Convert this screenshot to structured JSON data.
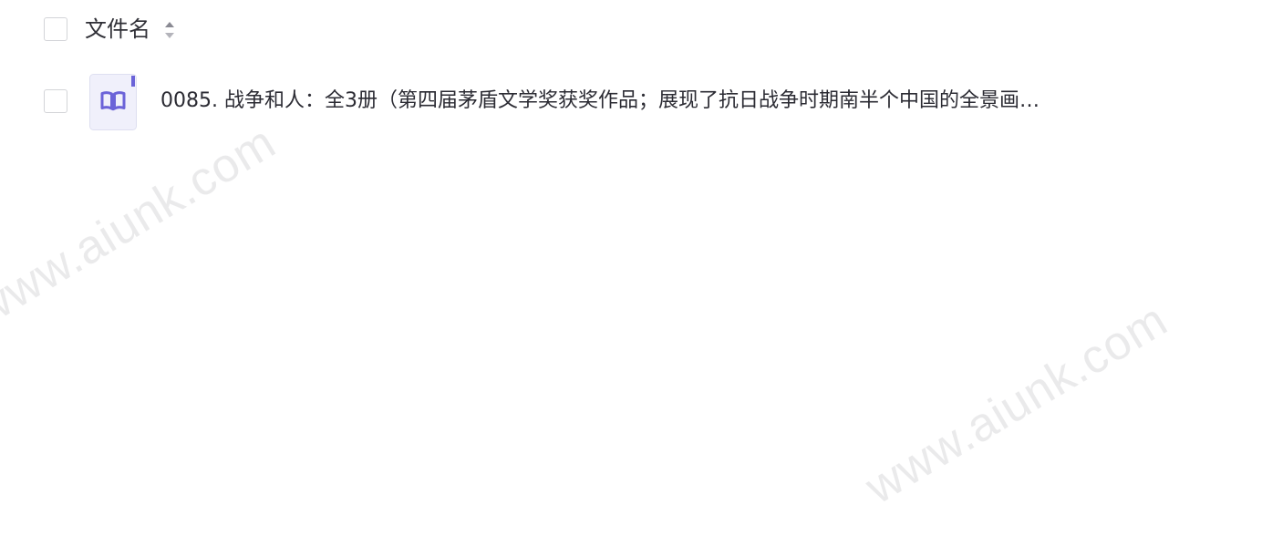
{
  "header": {
    "column_label": "文件名"
  },
  "files": [
    {
      "name": "0085. 战争和人：全3册（第四届茅盾文学奖获奖作品；展现了抗日战争时期南半个中国的全景画…",
      "icon": "book-icon"
    }
  ],
  "watermark": {
    "text": "www.aiunk.com"
  },
  "colors": {
    "icon_accent": "#6b63d8",
    "icon_bg": "#f0f0fb",
    "text": "#2b2b33",
    "checkbox_border": "#d3d4d8"
  }
}
